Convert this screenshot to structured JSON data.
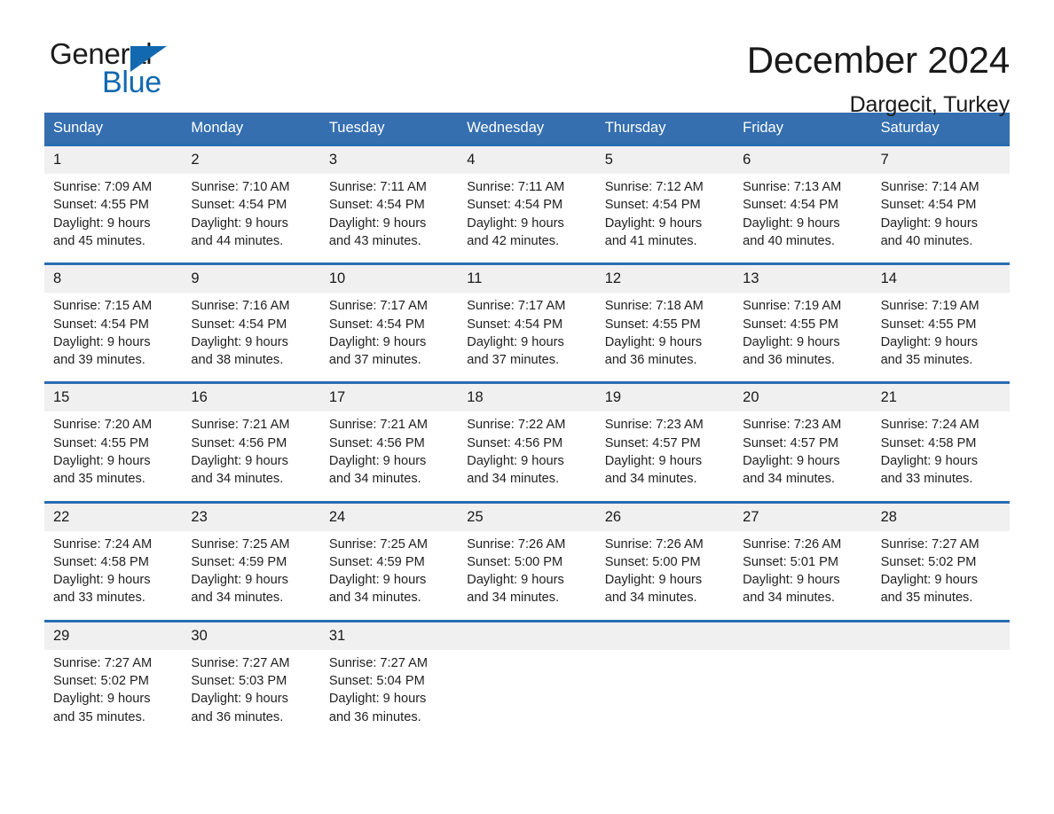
{
  "brand": {
    "name_part1": "General",
    "name_part2": "Blue",
    "triangle_color": "#1269b0"
  },
  "header": {
    "title": "December 2024",
    "location": "Dargecit, Turkey"
  },
  "theme": {
    "header_blue": "#356fb0",
    "rule_blue": "#2a6db3",
    "daynum_band": "#f0f0f0",
    "text": "#1a1a1a"
  },
  "weekday_headers": [
    "Sunday",
    "Monday",
    "Tuesday",
    "Wednesday",
    "Thursday",
    "Friday",
    "Saturday"
  ],
  "weeks": [
    {
      "daynums": [
        "1",
        "2",
        "3",
        "4",
        "5",
        "6",
        "7"
      ],
      "cells": [
        {
          "sunrise": "Sunrise: 7:09 AM",
          "sunset": "Sunset: 4:55 PM",
          "daylight1": "Daylight: 9 hours",
          "daylight2": "and 45 minutes."
        },
        {
          "sunrise": "Sunrise: 7:10 AM",
          "sunset": "Sunset: 4:54 PM",
          "daylight1": "Daylight: 9 hours",
          "daylight2": "and 44 minutes."
        },
        {
          "sunrise": "Sunrise: 7:11 AM",
          "sunset": "Sunset: 4:54 PM",
          "daylight1": "Daylight: 9 hours",
          "daylight2": "and 43 minutes."
        },
        {
          "sunrise": "Sunrise: 7:11 AM",
          "sunset": "Sunset: 4:54 PM",
          "daylight1": "Daylight: 9 hours",
          "daylight2": "and 42 minutes."
        },
        {
          "sunrise": "Sunrise: 7:12 AM",
          "sunset": "Sunset: 4:54 PM",
          "daylight1": "Daylight: 9 hours",
          "daylight2": "and 41 minutes."
        },
        {
          "sunrise": "Sunrise: 7:13 AM",
          "sunset": "Sunset: 4:54 PM",
          "daylight1": "Daylight: 9 hours",
          "daylight2": "and 40 minutes."
        },
        {
          "sunrise": "Sunrise: 7:14 AM",
          "sunset": "Sunset: 4:54 PM",
          "daylight1": "Daylight: 9 hours",
          "daylight2": "and 40 minutes."
        }
      ]
    },
    {
      "daynums": [
        "8",
        "9",
        "10",
        "11",
        "12",
        "13",
        "14"
      ],
      "cells": [
        {
          "sunrise": "Sunrise: 7:15 AM",
          "sunset": "Sunset: 4:54 PM",
          "daylight1": "Daylight: 9 hours",
          "daylight2": "and 39 minutes."
        },
        {
          "sunrise": "Sunrise: 7:16 AM",
          "sunset": "Sunset: 4:54 PM",
          "daylight1": "Daylight: 9 hours",
          "daylight2": "and 38 minutes."
        },
        {
          "sunrise": "Sunrise: 7:17 AM",
          "sunset": "Sunset: 4:54 PM",
          "daylight1": "Daylight: 9 hours",
          "daylight2": "and 37 minutes."
        },
        {
          "sunrise": "Sunrise: 7:17 AM",
          "sunset": "Sunset: 4:54 PM",
          "daylight1": "Daylight: 9 hours",
          "daylight2": "and 37 minutes."
        },
        {
          "sunrise": "Sunrise: 7:18 AM",
          "sunset": "Sunset: 4:55 PM",
          "daylight1": "Daylight: 9 hours",
          "daylight2": "and 36 minutes."
        },
        {
          "sunrise": "Sunrise: 7:19 AM",
          "sunset": "Sunset: 4:55 PM",
          "daylight1": "Daylight: 9 hours",
          "daylight2": "and 36 minutes."
        },
        {
          "sunrise": "Sunrise: 7:19 AM",
          "sunset": "Sunset: 4:55 PM",
          "daylight1": "Daylight: 9 hours",
          "daylight2": "and 35 minutes."
        }
      ]
    },
    {
      "daynums": [
        "15",
        "16",
        "17",
        "18",
        "19",
        "20",
        "21"
      ],
      "cells": [
        {
          "sunrise": "Sunrise: 7:20 AM",
          "sunset": "Sunset: 4:55 PM",
          "daylight1": "Daylight: 9 hours",
          "daylight2": "and 35 minutes."
        },
        {
          "sunrise": "Sunrise: 7:21 AM",
          "sunset": "Sunset: 4:56 PM",
          "daylight1": "Daylight: 9 hours",
          "daylight2": "and 34 minutes."
        },
        {
          "sunrise": "Sunrise: 7:21 AM",
          "sunset": "Sunset: 4:56 PM",
          "daylight1": "Daylight: 9 hours",
          "daylight2": "and 34 minutes."
        },
        {
          "sunrise": "Sunrise: 7:22 AM",
          "sunset": "Sunset: 4:56 PM",
          "daylight1": "Daylight: 9 hours",
          "daylight2": "and 34 minutes."
        },
        {
          "sunrise": "Sunrise: 7:23 AM",
          "sunset": "Sunset: 4:57 PM",
          "daylight1": "Daylight: 9 hours",
          "daylight2": "and 34 minutes."
        },
        {
          "sunrise": "Sunrise: 7:23 AM",
          "sunset": "Sunset: 4:57 PM",
          "daylight1": "Daylight: 9 hours",
          "daylight2": "and 34 minutes."
        },
        {
          "sunrise": "Sunrise: 7:24 AM",
          "sunset": "Sunset: 4:58 PM",
          "daylight1": "Daylight: 9 hours",
          "daylight2": "and 33 minutes."
        }
      ]
    },
    {
      "daynums": [
        "22",
        "23",
        "24",
        "25",
        "26",
        "27",
        "28"
      ],
      "cells": [
        {
          "sunrise": "Sunrise: 7:24 AM",
          "sunset": "Sunset: 4:58 PM",
          "daylight1": "Daylight: 9 hours",
          "daylight2": "and 33 minutes."
        },
        {
          "sunrise": "Sunrise: 7:25 AM",
          "sunset": "Sunset: 4:59 PM",
          "daylight1": "Daylight: 9 hours",
          "daylight2": "and 34 minutes."
        },
        {
          "sunrise": "Sunrise: 7:25 AM",
          "sunset": "Sunset: 4:59 PM",
          "daylight1": "Daylight: 9 hours",
          "daylight2": "and 34 minutes."
        },
        {
          "sunrise": "Sunrise: 7:26 AM",
          "sunset": "Sunset: 5:00 PM",
          "daylight1": "Daylight: 9 hours",
          "daylight2": "and 34 minutes."
        },
        {
          "sunrise": "Sunrise: 7:26 AM",
          "sunset": "Sunset: 5:00 PM",
          "daylight1": "Daylight: 9 hours",
          "daylight2": "and 34 minutes."
        },
        {
          "sunrise": "Sunrise: 7:26 AM",
          "sunset": "Sunset: 5:01 PM",
          "daylight1": "Daylight: 9 hours",
          "daylight2": "and 34 minutes."
        },
        {
          "sunrise": "Sunrise: 7:27 AM",
          "sunset": "Sunset: 5:02 PM",
          "daylight1": "Daylight: 9 hours",
          "daylight2": "and 35 minutes."
        }
      ]
    },
    {
      "daynums": [
        "29",
        "30",
        "31",
        "",
        "",
        "",
        ""
      ],
      "cells": [
        {
          "sunrise": "Sunrise: 7:27 AM",
          "sunset": "Sunset: 5:02 PM",
          "daylight1": "Daylight: 9 hours",
          "daylight2": "and 35 minutes."
        },
        {
          "sunrise": "Sunrise: 7:27 AM",
          "sunset": "Sunset: 5:03 PM",
          "daylight1": "Daylight: 9 hours",
          "daylight2": "and 36 minutes."
        },
        {
          "sunrise": "Sunrise: 7:27 AM",
          "sunset": "Sunset: 5:04 PM",
          "daylight1": "Daylight: 9 hours",
          "daylight2": "and 36 minutes."
        },
        {
          "sunrise": "",
          "sunset": "",
          "daylight1": "",
          "daylight2": ""
        },
        {
          "sunrise": "",
          "sunset": "",
          "daylight1": "",
          "daylight2": ""
        },
        {
          "sunrise": "",
          "sunset": "",
          "daylight1": "",
          "daylight2": ""
        },
        {
          "sunrise": "",
          "sunset": "",
          "daylight1": "",
          "daylight2": ""
        }
      ]
    }
  ]
}
